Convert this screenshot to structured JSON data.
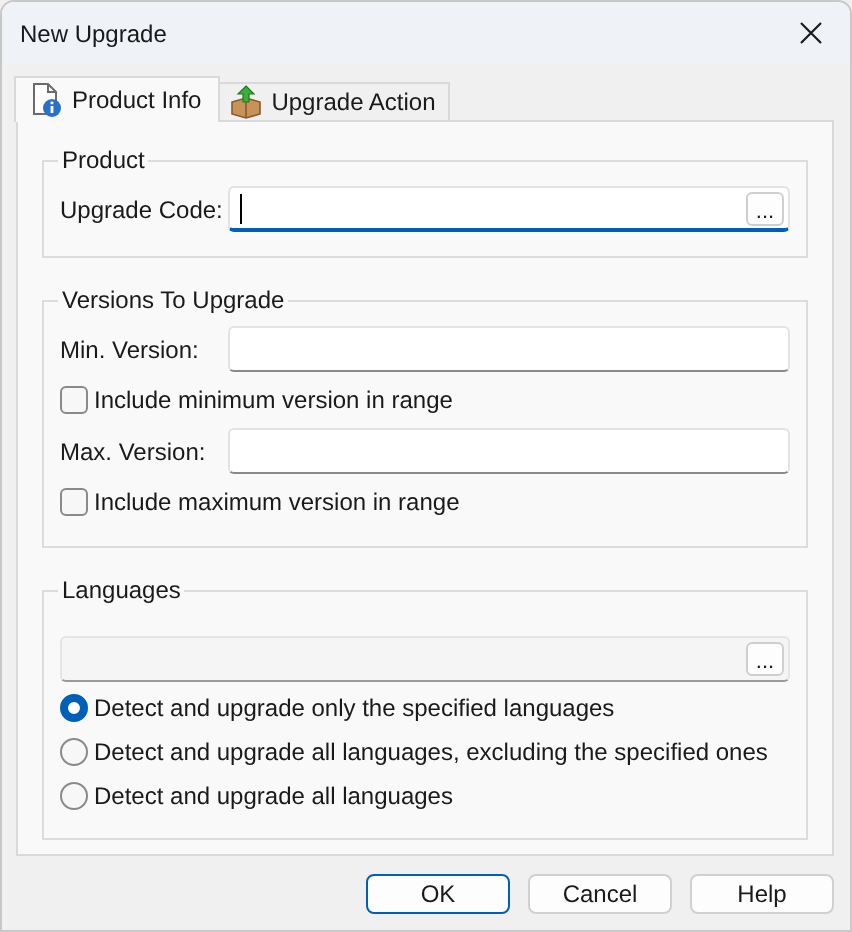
{
  "window": {
    "title": "New Upgrade"
  },
  "tabs": [
    {
      "label": "Product Info",
      "selected": true,
      "kind": "info"
    },
    {
      "label": "Upgrade Action",
      "selected": false,
      "kind": "box"
    }
  ],
  "groups": [
    {
      "title": "Product",
      "items": [
        {
          "kind": "field",
          "label": "Upgrade Code:",
          "browse": "...",
          "focused": true,
          "disabled": false
        }
      ]
    },
    {
      "title": "Versions To Upgrade",
      "items": [
        {
          "kind": "field",
          "label": "Min. Version:",
          "focused": false,
          "disabled": false
        },
        {
          "kind": "checkbox",
          "label": "Include minimum version in range",
          "checked": false
        },
        {
          "kind": "field",
          "label": "Max. Version:",
          "focused": false,
          "disabled": false
        },
        {
          "kind": "checkbox",
          "label": "Include maximum version in range",
          "checked": false
        }
      ]
    },
    {
      "title": "Languages",
      "items": [
        {
          "kind": "field",
          "browse": "...",
          "focused": false,
          "disabled": true
        },
        {
          "kind": "radio",
          "label": "Detect and upgrade only the specified languages",
          "selected": true
        },
        {
          "kind": "radio",
          "label": "Detect and upgrade all languages, excluding the specified ones",
          "selected": false
        },
        {
          "kind": "radio",
          "label": "Detect and upgrade all languages",
          "selected": false
        }
      ]
    }
  ],
  "buttons": [
    {
      "label": "OK",
      "default": true
    },
    {
      "label": "Cancel",
      "default": false
    },
    {
      "label": "Help",
      "default": false
    }
  ]
}
